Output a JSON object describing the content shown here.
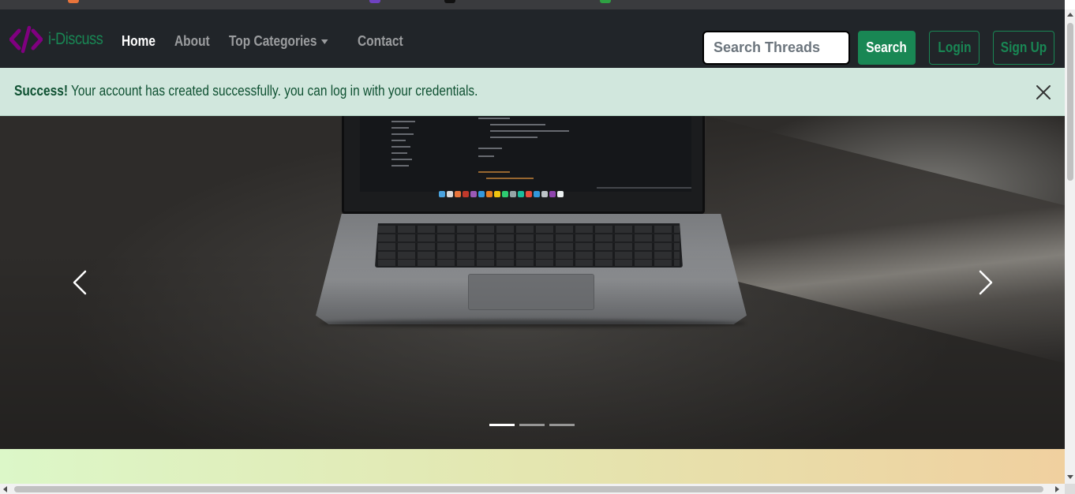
{
  "navbar": {
    "brand_name": "i-Discuss",
    "links": [
      {
        "label": "Home",
        "active": true
      },
      {
        "label": "About",
        "active": false
      },
      {
        "label": "Top Categories",
        "active": false,
        "dropdown": true
      },
      {
        "label": "Contact",
        "active": false
      }
    ],
    "search": {
      "placeholder": "Search Threads",
      "value": ""
    },
    "search_button": "Search",
    "login_button": "Login",
    "signup_button": "Sign Up"
  },
  "alert": {
    "strong": "Success!",
    "message": " Your account has created successfully. you can log in with your credentials.",
    "close_icon": "close-icon"
  },
  "carousel": {
    "slide_count": 3,
    "active_slide": 1,
    "prev_icon": "chevron-left-icon",
    "next_icon": "chevron-right-icon"
  },
  "colors": {
    "navbar_bg": "#212529",
    "brand_green": "#198754",
    "brand_icon_purple": "#800080",
    "alert_bg": "#d1e7dd",
    "alert_text": "#0f5132"
  }
}
